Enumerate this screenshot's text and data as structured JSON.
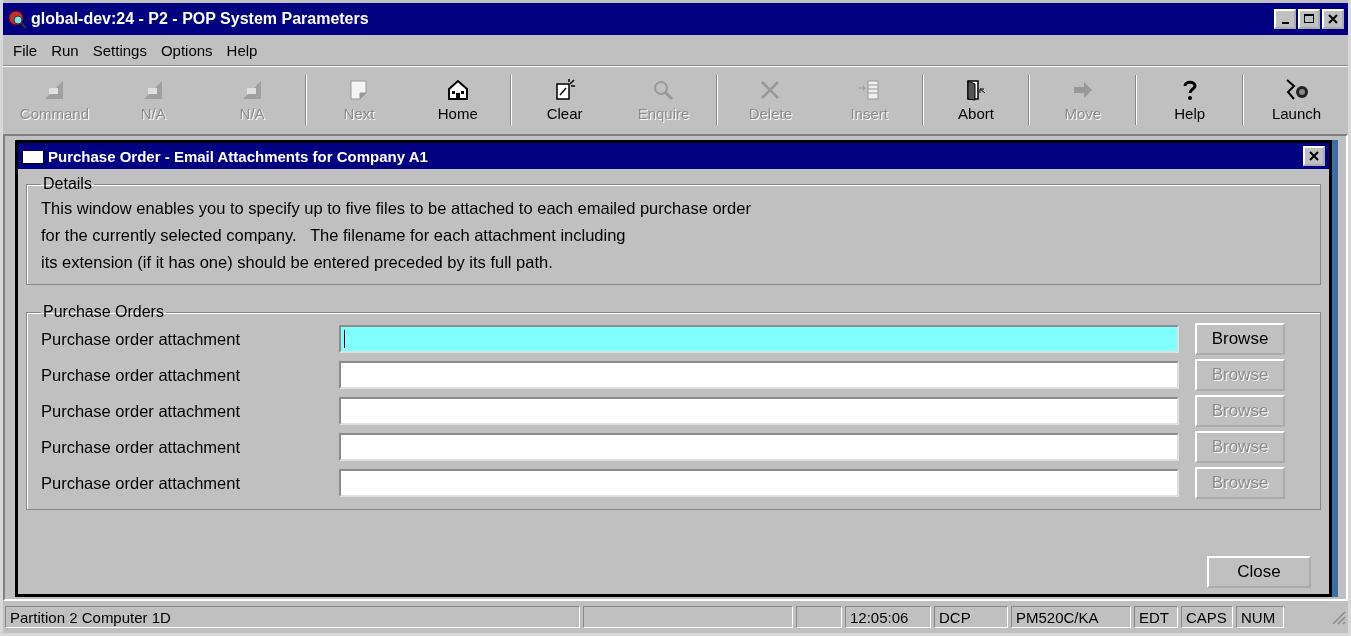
{
  "window": {
    "title": "global-dev:24 - P2 - POP System Parameters"
  },
  "menu": [
    "File",
    "Run",
    "Settings",
    "Options",
    "Help"
  ],
  "toolbar": [
    [
      {
        "label": "Command",
        "kind": "f1",
        "disabled": true
      },
      {
        "label": "N/A",
        "kind": "f2",
        "disabled": true
      },
      {
        "label": "N/A",
        "kind": "f3",
        "disabled": true
      }
    ],
    [
      {
        "label": "Next",
        "kind": "page",
        "disabled": true
      },
      {
        "label": "Home",
        "kind": "house",
        "disabled": false
      }
    ],
    [
      {
        "label": "Clear",
        "kind": "clear",
        "disabled": false
      },
      {
        "label": "Enquire",
        "kind": "magnifier",
        "disabled": true
      }
    ],
    [
      {
        "label": "Delete",
        "kind": "cross",
        "disabled": true
      },
      {
        "label": "Insert",
        "kind": "insert",
        "disabled": true
      }
    ],
    [
      {
        "label": "Abort",
        "kind": "door",
        "disabled": false
      }
    ],
    [
      {
        "label": "Move",
        "kind": "arrow",
        "disabled": true
      }
    ],
    [
      {
        "label": "Help",
        "kind": "question",
        "disabled": false
      }
    ],
    [
      {
        "label": "Launch",
        "kind": "launch",
        "disabled": false
      }
    ]
  ],
  "dialog": {
    "title": "Purchase Order - Email Attachments for Company A1",
    "details": {
      "legend": "Details",
      "lines": [
        "This window enables you to specify up to five files to be attached to each emailed purchase order",
        "for the currently selected company.   The filename for each attachment including",
        "its extension (if it has one) should be entered preceded by its full path."
      ]
    },
    "purchase_orders": {
      "legend": "Purchase Orders",
      "rows": [
        {
          "label": "Purchase order attachment",
          "focused": true,
          "browse": {
            "label": "Browse",
            "disabled": false
          }
        },
        {
          "label": "Purchase order attachment",
          "focused": false,
          "browse": {
            "label": "Browse",
            "disabled": true
          }
        },
        {
          "label": "Purchase order attachment",
          "focused": false,
          "browse": {
            "label": "Browse",
            "disabled": true
          }
        },
        {
          "label": "Purchase order attachment",
          "focused": false,
          "browse": {
            "label": "Browse",
            "disabled": true
          }
        },
        {
          "label": "Purchase order attachment",
          "focused": false,
          "browse": {
            "label": "Browse",
            "disabled": true
          }
        }
      ]
    },
    "close_button": "Close"
  },
  "status_bar": {
    "message": "Partition 2 Computer 1D",
    "indicators": [
      "12:05:06",
      "DCP",
      "PM520C/KA",
      "EDT",
      "CAPS",
      "NUM"
    ]
  }
}
